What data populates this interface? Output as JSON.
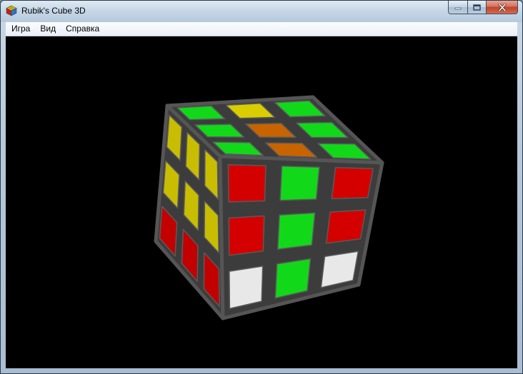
{
  "window": {
    "title": "Rubik's Cube 3D",
    "app_icon": "rubiks-cube-icon",
    "buttons": [
      "minimize-icon",
      "maximize-icon",
      "close-icon"
    ]
  },
  "menu": {
    "items": [
      "Игра",
      "Вид",
      "Справка"
    ]
  },
  "viewport": {
    "background": "#000000"
  },
  "cube": {
    "sticker_colors": {
      "green": "#12d81a",
      "yellow": "#d9cd00",
      "orange": "#c86400",
      "red": "#d40000",
      "white": "#e8e8e8"
    },
    "top_face": [
      [
        "green",
        "yellow",
        "green"
      ],
      [
        "green",
        "orange",
        "green"
      ],
      [
        "green",
        "orange",
        "green"
      ]
    ],
    "front_face": [
      [
        "red",
        "green",
        "red"
      ],
      [
        "red",
        "green",
        "red"
      ],
      [
        "white",
        "green",
        "white"
      ]
    ],
    "left_face": [
      [
        "yellow",
        "yellow",
        "yellow"
      ],
      [
        "yellow",
        "yellow",
        "yellow"
      ],
      [
        "red",
        "red",
        "red"
      ]
    ]
  }
}
